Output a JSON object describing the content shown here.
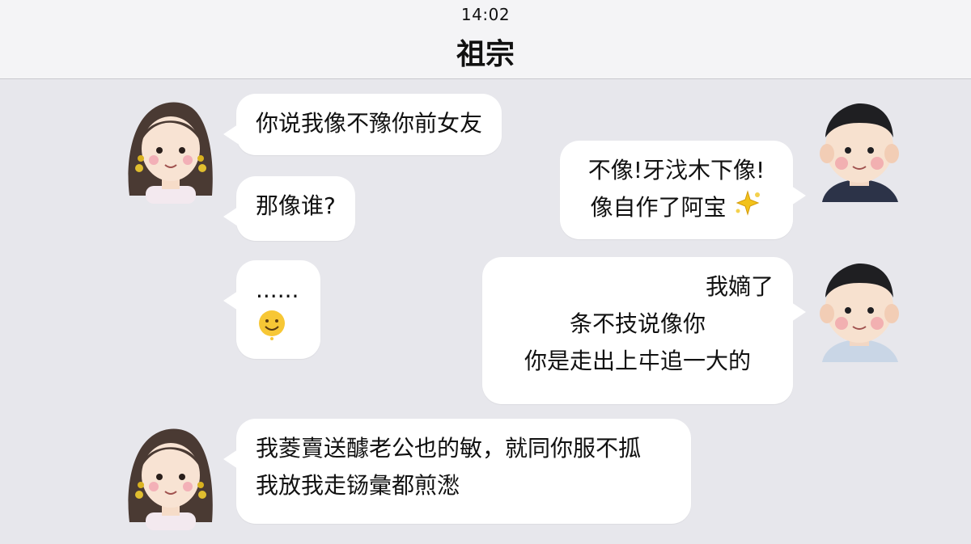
{
  "status_bar": {
    "time": "14:02"
  },
  "header": {
    "title": "祖宗"
  },
  "messages": [
    {
      "sender": "her",
      "lines": [
        "你说我像不豫你前女友"
      ]
    },
    {
      "sender": "her",
      "lines": [
        "那像谁?"
      ]
    },
    {
      "sender": "him",
      "lines": [
        "不像!牙㳀木下像!",
        "像自作了阿宝"
      ],
      "emoji": "sparkles-icon"
    },
    {
      "sender": "her",
      "lines": [
        "......"
      ],
      "emoji": "smiling-face-icon"
    },
    {
      "sender": "him",
      "lines": [
        "我嫡了",
        "条不技说像你",
        "你是走出上㐄追一大的"
      ]
    },
    {
      "sender": "her",
      "lines": [
        "我菱賣送醵老公也的敏，就同你服不㧓",
        "我放我走铴彙都煎㵞"
      ]
    }
  ],
  "colors": {
    "background": "#e7e7ec",
    "header": "#f4f4f6",
    "bubble": "#ffffff",
    "text": "#111111"
  }
}
